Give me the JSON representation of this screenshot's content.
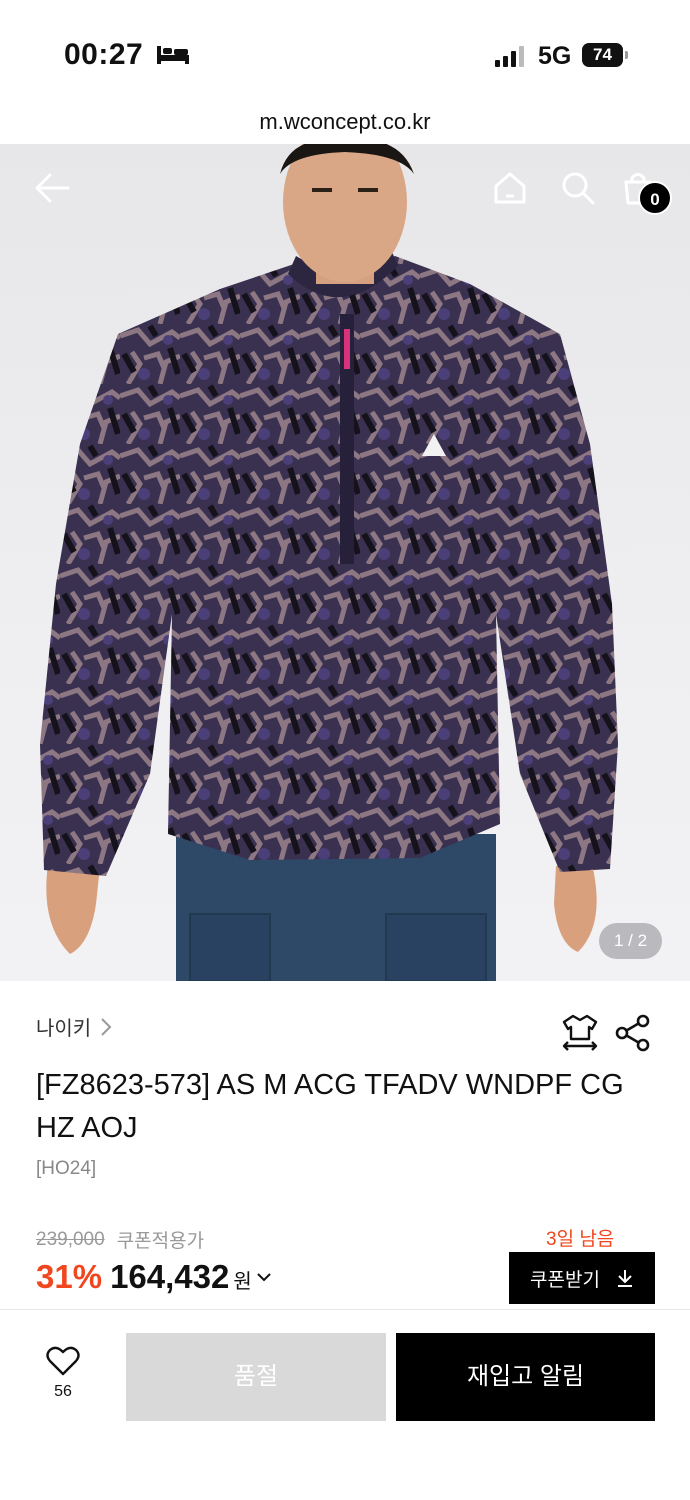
{
  "status_bar": {
    "time": "00:27",
    "network": "5G",
    "battery": "74"
  },
  "browser": {
    "url": "m.wconcept.co.kr"
  },
  "header": {
    "cart_count": "0",
    "back_icon": "arrow-left-icon",
    "home_icon": "home-icon",
    "search_icon": "search-icon",
    "bag_icon": "shopping-bag-icon"
  },
  "gallery": {
    "pager": "1 / 2"
  },
  "product": {
    "brand": "나이키",
    "title": "[FZ8623-573] AS M ACG TFADV WNDPF CG HZ AOJ",
    "season": "[HO24]",
    "original_price": "239,000",
    "coupon_note": "쿠폰적용가",
    "days_left": "3일 남음",
    "discount": "31%",
    "price": "164,432",
    "currency": "원",
    "coupon_button": "쿠폰받기"
  },
  "bottom_bar": {
    "like_count": "56",
    "soldout_label": "품절",
    "restock_label": "재입고 알림"
  },
  "colors": {
    "accent": "#f0471e",
    "black": "#000000",
    "disabled": "#d9d9d9"
  }
}
